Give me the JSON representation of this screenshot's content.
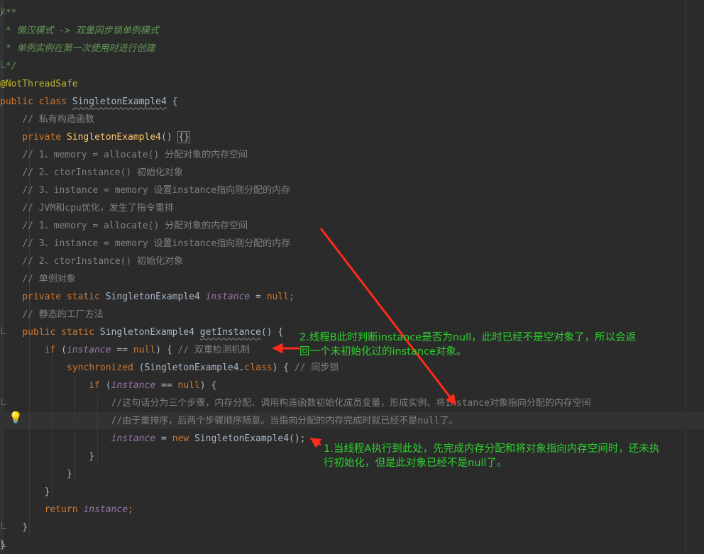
{
  "lines": [
    [
      {
        "c": "doc",
        "t": "/**"
      }
    ],
    [
      {
        "c": "doc",
        "t": " * 懒汉模式 -> 双重同步锁单例模式"
      }
    ],
    [
      {
        "c": "doc",
        "t": " * 单例实例在第一次使用时进行创建"
      }
    ],
    [
      {
        "c": "doc",
        "t": " */"
      }
    ],
    [
      {
        "c": "ann",
        "t": "@NotThreadSafe"
      }
    ],
    [
      {
        "c": "kw",
        "t": "public class "
      },
      {
        "c": "cls-u",
        "t": "SingletonExample4"
      },
      {
        "t": " {"
      }
    ],
    [
      {
        "t": "    "
      },
      {
        "c": "cm",
        "t": "// 私有构造函数"
      }
    ],
    [
      {
        "t": "    "
      },
      {
        "c": "kw",
        "t": "private "
      },
      {
        "c": "fn",
        "t": "SingletonExample4"
      },
      {
        "t": "() "
      },
      {
        "c": "brace-hl",
        "t": "{}"
      }
    ],
    [
      {
        "t": "    "
      },
      {
        "c": "cm",
        "t": "// 1、memory = allocate() 分配对象的内存空间"
      }
    ],
    [
      {
        "t": "    "
      },
      {
        "c": "cm",
        "t": "// 2、ctorInstance() 初始化对象"
      }
    ],
    [
      {
        "t": "    "
      },
      {
        "c": "cm",
        "t": "// 3、instance = memory 设置instance指向刚分配的内存"
      }
    ],
    [
      {
        "t": "    "
      },
      {
        "c": "cm",
        "t": "// JVM和cpu优化，发生了指令重排"
      }
    ],
    [
      {
        "t": "    "
      },
      {
        "c": "cm",
        "t": "// 1、memory = allocate() 分配对象的内存空间"
      }
    ],
    [
      {
        "t": "    "
      },
      {
        "c": "cm",
        "t": "// 3、instance = memory 设置instance指向刚分配的内存"
      }
    ],
    [
      {
        "t": "    "
      },
      {
        "c": "cm",
        "t": "// 2、ctorInstance() 初始化对象"
      }
    ],
    [
      {
        "t": "    "
      },
      {
        "c": "cm",
        "t": "// 单例对象"
      }
    ],
    [
      {
        "t": "    "
      },
      {
        "c": "kw",
        "t": "private static "
      },
      {
        "t": "SingletonExample4 "
      },
      {
        "c": "fld",
        "t": "instance"
      },
      {
        "t": " = "
      },
      {
        "c": "kw",
        "t": "null;"
      }
    ],
    [
      {
        "t": "    "
      },
      {
        "c": "cm",
        "t": "// 静态的工厂方法"
      }
    ],
    [
      {
        "t": "    "
      },
      {
        "c": "kw",
        "t": "public static "
      },
      {
        "t": "SingletonExample4 "
      },
      {
        "c": "cls-u",
        "t": "getInstance"
      },
      {
        "t": "() {"
      }
    ],
    [
      {
        "t": "        "
      },
      {
        "c": "kw",
        "t": "if "
      },
      {
        "t": "("
      },
      {
        "c": "fld",
        "t": "instance"
      },
      {
        "t": " == "
      },
      {
        "c": "kw",
        "t": "null"
      },
      {
        "t": ") { "
      },
      {
        "c": "cm",
        "t": "// 双重检测机制"
      }
    ],
    [
      {
        "t": "            "
      },
      {
        "c": "kw",
        "t": "synchronized "
      },
      {
        "t": "(SingletonExample4."
      },
      {
        "c": "kw",
        "t": "class"
      },
      {
        "t": ") { "
      },
      {
        "c": "cm",
        "t": "// 同步锁"
      }
    ],
    [
      {
        "t": "                "
      },
      {
        "c": "kw",
        "t": "if "
      },
      {
        "t": "("
      },
      {
        "c": "fld",
        "t": "instance"
      },
      {
        "t": " == "
      },
      {
        "c": "kw",
        "t": "null"
      },
      {
        "t": ") {"
      }
    ],
    [
      {
        "t": "                    "
      },
      {
        "c": "cm",
        "t": "//这句话分为三个步骤，内存分配、调用构造函数初始化成员变量，形成实例、将instance对象指向分配的内存空间"
      }
    ],
    [
      {
        "t": "                    "
      },
      {
        "c": "cm",
        "t": "//由于重排序，后两个步骤顺序随意。当指向分配的内存完成时就已经不是null了。"
      }
    ],
    [
      {
        "t": "                    "
      },
      {
        "c": "fld",
        "t": "instance"
      },
      {
        "t": " = "
      },
      {
        "c": "kw",
        "t": "new "
      },
      {
        "t": "SingletonExample4();"
      }
    ],
    [
      {
        "t": "                }"
      }
    ],
    [
      {
        "t": "            }"
      }
    ],
    [
      {
        "t": "        }"
      }
    ],
    [
      {
        "t": "        "
      },
      {
        "c": "kw",
        "t": "return "
      },
      {
        "c": "fld",
        "t": "instance"
      },
      {
        "c": "kw",
        "t": ";"
      }
    ],
    [
      {
        "t": "    }"
      }
    ],
    [
      {
        "t": "}"
      }
    ]
  ],
  "annotations": {
    "thread_b": {
      "line1": "2.线程B此时判断instance是否为null，此时已经不是空对象了，所以会返",
      "line2": "回一个未初始化过的instance对象。"
    },
    "thread_a": {
      "line1": "1.当线程A执行到此处，先完成内存分配和将对象指向内存空间时，还未执",
      "line2": "行初始化，但是此对象已经不是null了。"
    }
  },
  "colors": {
    "background": "#2b2b2b",
    "keyword": "#cc7832",
    "comment": "#808080",
    "doc_comment": "#629755",
    "annotation": "#bbb529",
    "field": "#9876aa",
    "method": "#ffc66d",
    "default_text": "#a9b7c6",
    "note_text": "#2fd12f",
    "arrow": "#ff2a1a"
  },
  "icons": {
    "intention": "lightbulb-icon"
  }
}
